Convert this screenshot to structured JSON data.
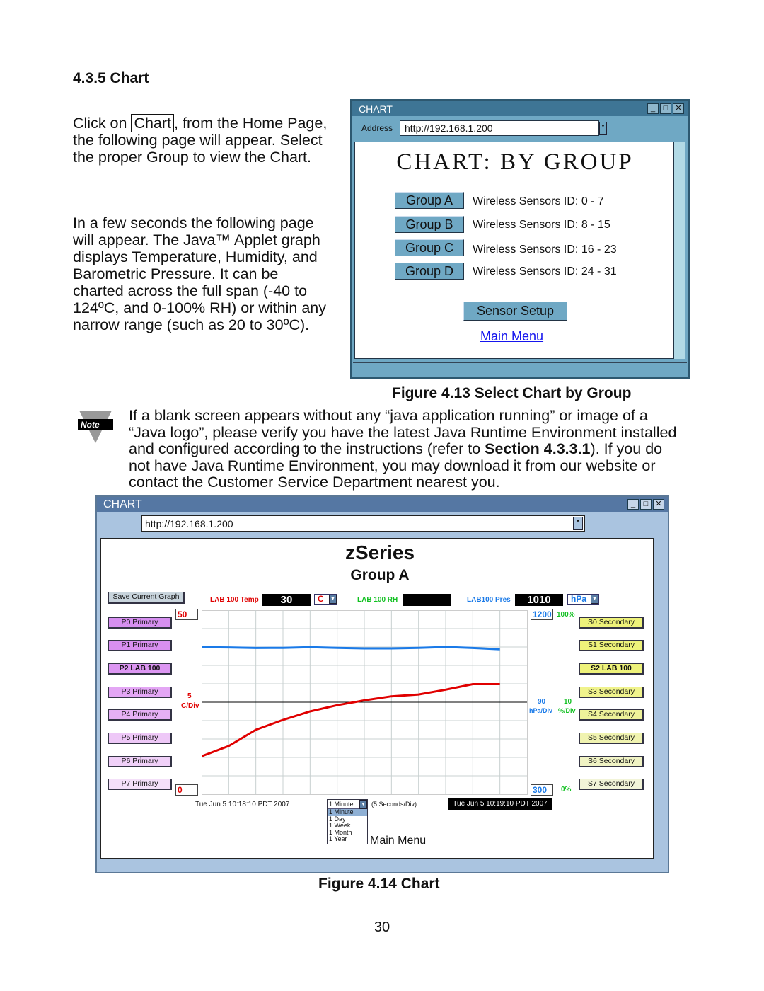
{
  "section_heading": "4.3.5  Chart",
  "intro": {
    "pre": "Click on ",
    "chart_word": "Chart",
    "post": ", from the Home Page,",
    "rest": "the following page will appear. Select\nthe proper Group to view the Chart."
  },
  "para2": "In a few seconds the following page\nwill appear.  The Java™ Applet graph\ndisplays Temperature, Humidity, and\nBarometric Pressure.  It can be\ncharted across the full span (-40 to\n124ºC, and 0-100% RH) or within any\nnarrow range (such as 20 to 30ºC).",
  "window1": {
    "title": "CHART",
    "address_label": "Address",
    "address": "http://192.168.1.200",
    "heading": "CHART: BY GROUP",
    "groups": [
      {
        "button": "Group A",
        "label": "Wireless Sensors ID:  0 - 7"
      },
      {
        "button": "Group B",
        "label": "Wireless Sensors ID:  8 - 15"
      },
      {
        "button": "Group C",
        "label": "Wireless Sensors ID:  16 - 23"
      },
      {
        "button": "Group D",
        "label": "Wireless Sensors ID:  24 - 31"
      }
    ],
    "sensor_setup": "Sensor Setup",
    "main_menu": "Main Menu"
  },
  "figure1_caption": "Figure 4.13 Select Chart by Group",
  "note": {
    "icon_text": "Note",
    "line1": "If a blank screen appears without any “java application running” or image of a",
    "line2": "“Java logo”, please verify you have the latest Java Runtime Environment installed",
    "line3_pre": "and configured according to the instructions (refer to ",
    "line3_bold": "Section 4.3.3.1",
    "line3_post": ").  If you do",
    "line4": "not have Java Runtime Environment, you may download it from our website or",
    "line5": "contact the Customer Service Department nearest you."
  },
  "window2": {
    "title": "CHART",
    "address": "http://192.168.1.200",
    "heading": "zSeries",
    "subheading": "Group A",
    "save_button": "Save Current Graph",
    "temp": {
      "label": "LAB 100 Temp",
      "value": "30",
      "unit": "C",
      "color": "#e00000"
    },
    "rh": {
      "label": "LAB 100  RH",
      "value": "",
      "color": "#10c020"
    },
    "pres": {
      "label": "LAB100  Pres",
      "value": "1010",
      "unit": "hPa",
      "color": "#1a7ae8"
    },
    "primary_buttons": [
      "P0 Primary",
      "P1 Primary",
      "P2 LAB 100",
      "P3 Primary",
      "P4 Primary",
      "P5 Primary",
      "P6 Primary",
      "P7 Primary"
    ],
    "secondary_buttons": [
      "S0 Secondary",
      "S1 Secondary",
      "S2 LAB 100",
      "S3 Secondary",
      "S4 Secondary",
      "S5 Secondary",
      "S6 Secondary",
      "S7 Secondary"
    ],
    "temp_max": "50",
    "temp_min": "0",
    "temp_div_value": "5",
    "temp_div_unit": "C/Div",
    "pres_max": "1200",
    "pres_min": "300",
    "pres_div_value": "90",
    "pres_div_unit": "hPa/Div",
    "rh_max": "100%",
    "rh_min": "0%",
    "rh_div_value": "10",
    "rh_div_unit": "%/Div",
    "start_time": "Tue Jun 5 10:18:10 PDT 2007",
    "end_time": "Tue Jun 5 10:19:10 PDT 2007",
    "span_select": "1 Minute",
    "span_options": [
      "1 Minute",
      "1 Day",
      "1 Week",
      "1 Month",
      "1 Year"
    ],
    "span_note": "(5 Seconds/Div)",
    "main_menu": "Main Menu"
  },
  "chart_data": {
    "type": "line",
    "x_unit_seconds": [
      0,
      5,
      10,
      15,
      20,
      25,
      30,
      35,
      40,
      45,
      50,
      55
    ],
    "xlim": [
      0,
      60
    ],
    "grid": true,
    "series": [
      {
        "name": "LAB 100 Temp",
        "color": "#e00000",
        "axis": "left",
        "ylim": [
          0,
          50
        ],
        "values": [
          10.3,
          13.1,
          17.5,
          20.2,
          22.5,
          24.2,
          25.5,
          26.6,
          27.1,
          28.4,
          29.9,
          29.9
        ]
      },
      {
        "name": "LAB100  Pres",
        "color": "#1a7ae8",
        "axis": "right",
        "ylim": [
          300,
          1200
        ],
        "values": [
          1019,
          1018,
          1015,
          1016,
          1019,
          1016,
          1013,
          1013,
          1016,
          1020,
          1015,
          1009
        ]
      }
    ]
  },
  "figure2_caption": "Figure 4.14  Chart",
  "page_number": "30"
}
